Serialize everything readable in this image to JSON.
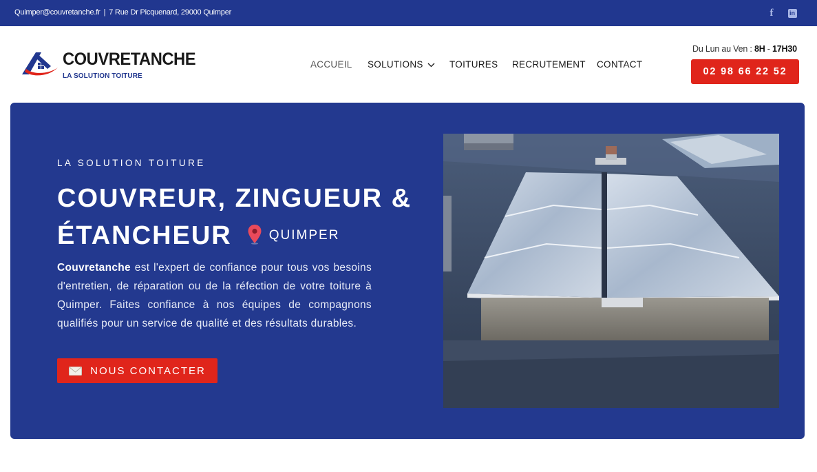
{
  "topbar": {
    "email": "Quimper@couvretanche.fr",
    "separator": "|",
    "address": "7 Rue Dr Picquenard, 29000 Quimper",
    "facebook_glyph": "f",
    "linkedin_glyph": "in"
  },
  "brand": {
    "name": "COUVRETANCHE",
    "tagline": "LA SOLUTION TOITURE",
    "colors": {
      "blue": "#21378f",
      "red": "#e0251b"
    }
  },
  "nav": {
    "items": [
      {
        "label": "ACCUEIL",
        "active": true
      },
      {
        "label": "SOLUTIONS",
        "has_dropdown": true
      },
      {
        "label": "TOITURES"
      },
      {
        "label": "RECRUTEMENT"
      },
      {
        "label": "CONTACT"
      }
    ]
  },
  "contact": {
    "hours_prefix": "Du Lun au Ven : ",
    "hours_start": "8H",
    "hours_sep": " - ",
    "hours_end": "17H30",
    "phone": "02 98 66 22 52"
  },
  "hero": {
    "eyebrow": "LA SOLUTION TOITURE",
    "headline_line1": "COUVREUR, ZINGUEUR &",
    "headline_line2": "ÉTANCHEUR",
    "city": "QUIMPER",
    "desc_bold": "Couvretanche",
    "desc_rest": " est l'expert de confiance pour tous vos besoins d'entretien, de réparation ou de la réfection de votre toiture à Quimper. Faites confiance à nos équipes de compagnons qualifiés pour un service de qualité et des résultats durables.",
    "cta_label": "NOUS CONTACTER",
    "icons": {
      "location": "map-pin-icon",
      "mail": "envelope-icon"
    }
  }
}
